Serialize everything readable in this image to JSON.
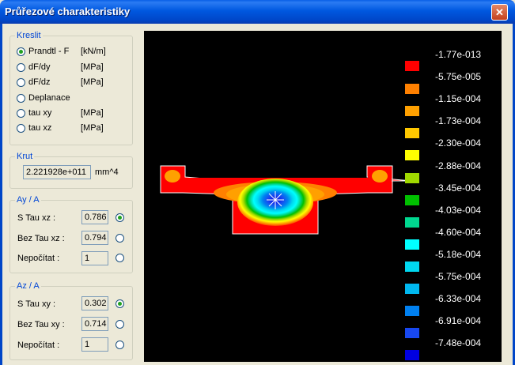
{
  "window": {
    "title": "Průřezové charakteristiky"
  },
  "kreslit": {
    "title": "Kreslit",
    "options": [
      {
        "label": "Prandtl - F",
        "unit": "[kN/m]",
        "selected": true
      },
      {
        "label": "dF/dy",
        "unit": "[MPa]",
        "selected": false
      },
      {
        "label": "dF/dz",
        "unit": "[MPa]",
        "selected": false
      },
      {
        "label": "Deplanace",
        "unit": "",
        "selected": false
      },
      {
        "label": "tau xy",
        "unit": "[MPa]",
        "selected": false
      },
      {
        "label": "tau xz",
        "unit": "[MPa]",
        "selected": false
      }
    ]
  },
  "krut": {
    "title": "Krut",
    "value": "2.221928e+011",
    "unit": "mm^4"
  },
  "ay": {
    "title": "Ay / A",
    "rows": [
      {
        "label": "S Tau xz :",
        "value": "0.786",
        "selected": true
      },
      {
        "label": "Bez Tau xz :",
        "value": "0.794",
        "selected": false
      },
      {
        "label": "Nepočítat :",
        "value": "1",
        "selected": false
      }
    ]
  },
  "az": {
    "title": "Az / A",
    "rows": [
      {
        "label": "S Tau xy :",
        "value": "0.302",
        "selected": true
      },
      {
        "label": "Bez Tau xy :",
        "value": "0.714",
        "selected": false
      },
      {
        "label": "Nepočítat :",
        "value": "1",
        "selected": false
      }
    ]
  },
  "legend": [
    {
      "value": "-1.77e-013",
      "color": "#FF0000"
    },
    {
      "value": "-5.75e-005",
      "color": "#FF8000"
    },
    {
      "value": "-1.15e-004",
      "color": "#FFA000"
    },
    {
      "value": "-1.73e-004",
      "color": "#FFC800"
    },
    {
      "value": "-2.30e-004",
      "color": "#FFFF00"
    },
    {
      "value": "-2.88e-004",
      "color": "#A0D800"
    },
    {
      "value": "-3.45e-004",
      "color": "#00C000"
    },
    {
      "value": "-4.03e-004",
      "color": "#00D890"
    },
    {
      "value": "-4.60e-004",
      "color": "#00FFFF"
    },
    {
      "value": "-5.18e-004",
      "color": "#00D8F0"
    },
    {
      "value": "-5.75e-004",
      "color": "#00B8F0"
    },
    {
      "value": "-6.33e-004",
      "color": "#0080F0"
    },
    {
      "value": "-6.91e-004",
      "color": "#1848F0"
    },
    {
      "value": "-7.48e-004",
      "color": "#0000E0"
    }
  ]
}
